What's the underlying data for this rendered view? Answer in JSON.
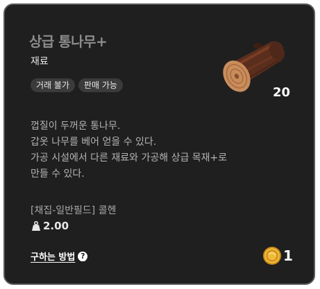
{
  "item": {
    "title": "상급 통나무+",
    "category": "재료",
    "badges": [
      "거래 불가",
      "판매 가능"
    ],
    "count": "20",
    "description": [
      "껍질이 두꺼운 통나무.",
      "갑옷 나무를 베어 얻을 수 있다.",
      "가공 시설에서 다른 재료와 가공해 상급 목재+로",
      "만들 수 있다."
    ],
    "source": "[채집-일반필드] 콜헨",
    "weight": "2.00",
    "how_to_get": "구하는 방법",
    "price": "1"
  },
  "colors": {
    "background": "#1f1f20",
    "border": "#5a5a5a",
    "title": "#8c8c8c",
    "badge_bg": "#3b3b3c",
    "coin": "#e0a82a"
  },
  "icons": {
    "item": "log-icon",
    "weight": "weight-icon",
    "help": "question-circle-icon",
    "currency": "gold-coin-icon"
  }
}
